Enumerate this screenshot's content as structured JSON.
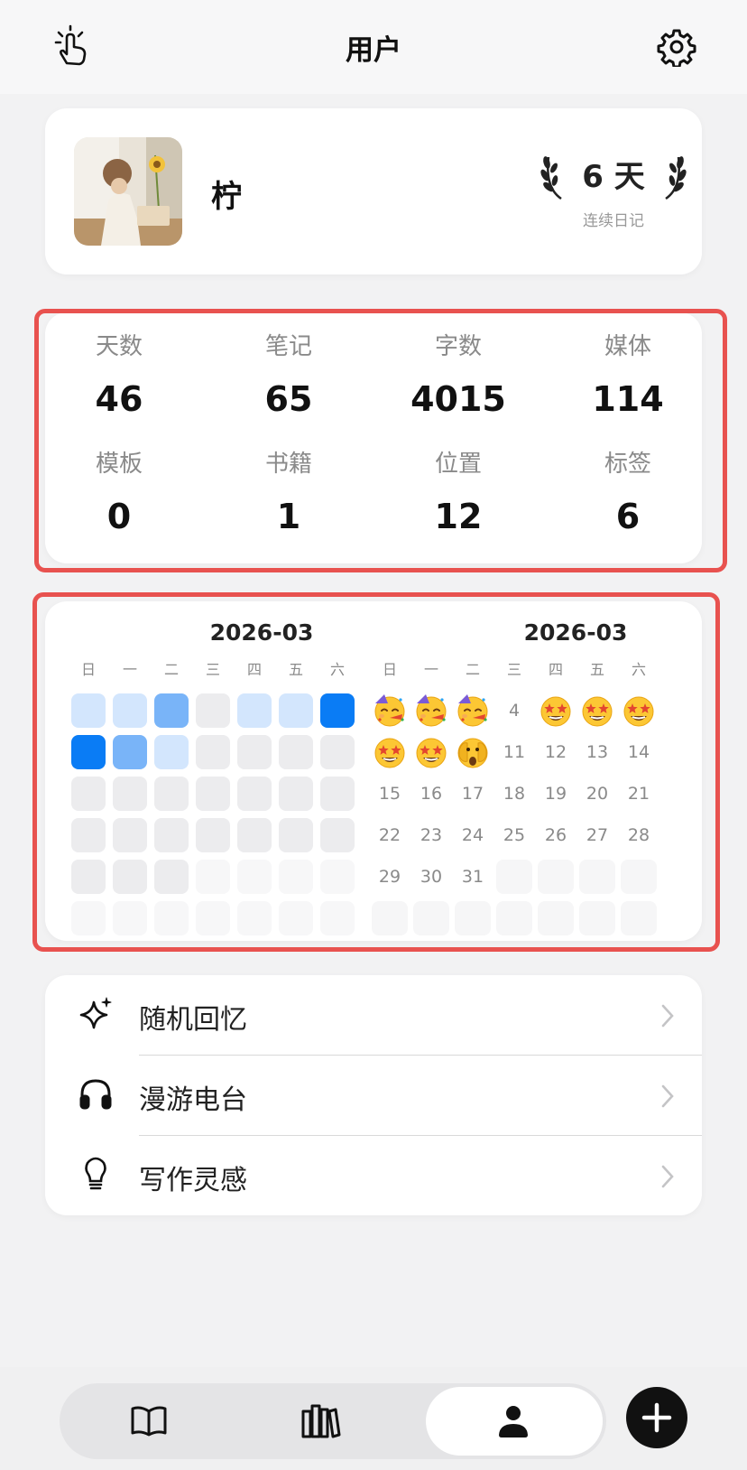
{
  "header": {
    "title": "用户",
    "left_icon": "tap-hand-icon",
    "right_icon": "gear-icon"
  },
  "profile": {
    "name": "柠",
    "streak_value": "6 天",
    "streak_label": "连续日记"
  },
  "stats": [
    {
      "label": "天数",
      "value": "46"
    },
    {
      "label": "笔记",
      "value": "65"
    },
    {
      "label": "字数",
      "value": "4015"
    },
    {
      "label": "媒体",
      "value": "114"
    },
    {
      "label": "模板",
      "value": "0"
    },
    {
      "label": "书籍",
      "value": "1"
    },
    {
      "label": "位置",
      "value": "12"
    },
    {
      "label": "标签",
      "value": "6"
    }
  ],
  "heatmap": {
    "month": "2026-03",
    "weekdays": [
      "日",
      "一",
      "二",
      "三",
      "四",
      "五",
      "六"
    ],
    "levels": [
      [
        1,
        1,
        2,
        0,
        1,
        1,
        3
      ],
      [
        3,
        2,
        1,
        0,
        0,
        0,
        0
      ],
      [
        0,
        0,
        0,
        0,
        0,
        0,
        0
      ],
      [
        0,
        0,
        0,
        0,
        0,
        0,
        0
      ],
      [
        0,
        0,
        0,
        -1,
        -1,
        -1,
        -1
      ],
      [
        -1,
        -1,
        -1,
        -1,
        -1,
        -1,
        -1
      ]
    ],
    "colors": {
      "0": "#ececee",
      "1": "#d3e6fd",
      "2": "#79b4f8",
      "3": "#0a7cf5",
      "-1": "#f7f7f8"
    }
  },
  "mood_calendar": {
    "month": "2026-03",
    "weekdays": [
      "日",
      "一",
      "二",
      "三",
      "四",
      "五",
      "六"
    ],
    "days": [
      {
        "day": "1",
        "mood": "party-face-icon"
      },
      {
        "day": "2",
        "mood": "party-face-icon"
      },
      {
        "day": "3",
        "mood": "party-face-icon"
      },
      {
        "day": "4",
        "mood": ""
      },
      {
        "day": "5",
        "mood": "star-struck-icon"
      },
      {
        "day": "6",
        "mood": "star-struck-icon"
      },
      {
        "day": "7",
        "mood": "star-struck-icon"
      },
      {
        "day": "8",
        "mood": "star-struck-icon"
      },
      {
        "day": "9",
        "mood": "star-struck-icon"
      },
      {
        "day": "10",
        "mood": "peeking-face-icon"
      },
      {
        "day": "11",
        "mood": ""
      },
      {
        "day": "12",
        "mood": ""
      },
      {
        "day": "13",
        "mood": ""
      },
      {
        "day": "14",
        "mood": ""
      },
      {
        "day": "15",
        "mood": ""
      },
      {
        "day": "16",
        "mood": ""
      },
      {
        "day": "17",
        "mood": ""
      },
      {
        "day": "18",
        "mood": ""
      },
      {
        "day": "19",
        "mood": ""
      },
      {
        "day": "20",
        "mood": ""
      },
      {
        "day": "21",
        "mood": ""
      },
      {
        "day": "22",
        "mood": ""
      },
      {
        "day": "23",
        "mood": ""
      },
      {
        "day": "24",
        "mood": ""
      },
      {
        "day": "25",
        "mood": ""
      },
      {
        "day": "26",
        "mood": ""
      },
      {
        "day": "27",
        "mood": ""
      },
      {
        "day": "28",
        "mood": ""
      },
      {
        "day": "29",
        "mood": ""
      },
      {
        "day": "30",
        "mood": ""
      },
      {
        "day": "31",
        "mood": ""
      }
    ]
  },
  "menu": [
    {
      "label": "随机回忆",
      "icon": "sparkles-icon"
    },
    {
      "label": "漫游电台",
      "icon": "headphones-icon"
    },
    {
      "label": "写作灵感",
      "icon": "lightbulb-icon"
    }
  ],
  "tabbar": {
    "tabs": [
      "book-icon",
      "library-icon",
      "user-icon"
    ],
    "active": "user-icon",
    "fab_icon": "plus-icon"
  },
  "highlight_color": "#e8524f"
}
